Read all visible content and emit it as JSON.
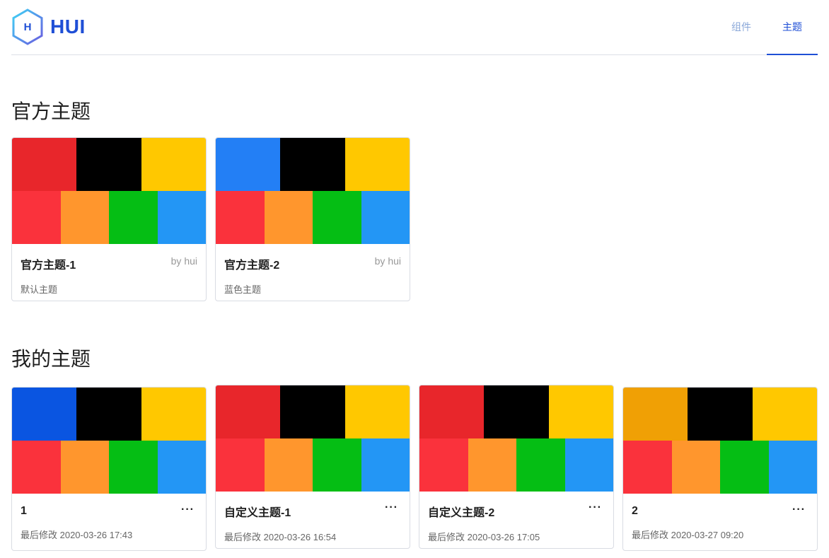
{
  "brand": {
    "name": "HUI",
    "mark_letter": "H"
  },
  "nav": {
    "components": "组件",
    "themes": "主题"
  },
  "sections": {
    "official": "官方主题",
    "mine": "我的主题"
  },
  "official_themes": [
    {
      "title": "官方主题-1",
      "author": "by hui",
      "desc": "默认主题",
      "top": [
        "#e8262b",
        "#000000",
        "#ffc800"
      ],
      "bottom": [
        "#fa323c",
        "#ff962d",
        "#05be14",
        "#2396f5"
      ]
    },
    {
      "title": "官方主题-2",
      "author": "by hui",
      "desc": "蓝色主题",
      "top": [
        "#237ff5",
        "#000000",
        "#ffc800"
      ],
      "bottom": [
        "#fa323c",
        "#ff962d",
        "#05be14",
        "#2396f5"
      ]
    }
  ],
  "my_themes": [
    {
      "title": "1",
      "modified": "最后修改 2020-03-26 17:43",
      "more": "···",
      "top": [
        "#0a55e1",
        "#000000",
        "#ffc800"
      ],
      "bottom": [
        "#fa323c",
        "#ff962d",
        "#05be14",
        "#2396f5"
      ]
    },
    {
      "title": "自定义主题-1",
      "modified": "最后修改 2020-03-26 16:54",
      "more": "···",
      "top": [
        "#e8262b",
        "#000000",
        "#ffc800"
      ],
      "bottom": [
        "#fa323c",
        "#ff962d",
        "#05be14",
        "#2396f5"
      ]
    },
    {
      "title": "自定义主题-2",
      "modified": "最后修改 2020-03-26 17:05",
      "more": "···",
      "top": [
        "#e8262b",
        "#000000",
        "#ffc800"
      ],
      "bottom": [
        "#fa323c",
        "#ff962d",
        "#05be14",
        "#2396f5"
      ]
    },
    {
      "title": "2",
      "modified": "最后修改 2020-03-27 09:20",
      "more": "···",
      "top": [
        "#f0a005",
        "#000000",
        "#ffc800"
      ],
      "bottom": [
        "#fa323c",
        "#ff962d",
        "#05be14",
        "#2396f5"
      ]
    }
  ],
  "colors": {
    "accent": "#1f4fd6",
    "nav_inactive": "#8aa7d8",
    "divider": "#dcdfe6"
  }
}
